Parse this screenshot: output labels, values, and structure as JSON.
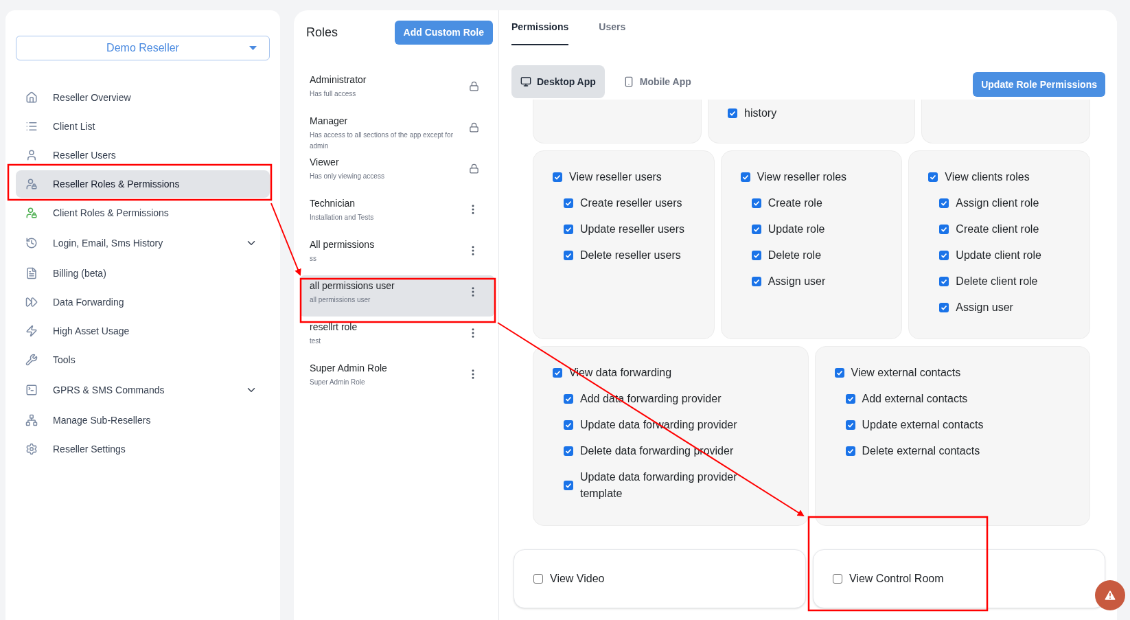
{
  "account_select": {
    "value": "Demo Reseller"
  },
  "sidebar": {
    "items": [
      {
        "label": "Reseller Overview",
        "selected": false
      },
      {
        "label": "Client List",
        "selected": false
      },
      {
        "label": "Reseller Users",
        "selected": false
      },
      {
        "label": "Reseller Roles & Permissions",
        "selected": true
      },
      {
        "label": "Client Roles & Permissions",
        "selected": false
      },
      {
        "label": "Login, Email, Sms History",
        "selected": false,
        "expanded": false
      },
      {
        "label": "Billing (beta)",
        "selected": false
      },
      {
        "label": "Data Forwarding",
        "selected": false
      },
      {
        "label": "High Asset Usage",
        "selected": false
      },
      {
        "label": "Tools",
        "selected": false
      },
      {
        "label": "GPRS & SMS Commands",
        "selected": false,
        "expanded": false
      },
      {
        "label": "Manage Sub-Resellers",
        "selected": false
      },
      {
        "label": "Reseller Settings",
        "selected": false
      }
    ]
  },
  "roles": {
    "title": "Roles",
    "add_button": "Add Custom Role",
    "items": [
      {
        "name": "Administrator",
        "description": "Has full access",
        "locked": true,
        "selected": false
      },
      {
        "name": "Manager",
        "description": "Has access to all sections of the app except for admin",
        "locked": true,
        "selected": false
      },
      {
        "name": "Viewer",
        "description": "Has only viewing access",
        "locked": true,
        "selected": false
      },
      {
        "name": "Technician",
        "description": "Installation and Tests",
        "locked": false,
        "selected": false
      },
      {
        "name": "All permissions",
        "description": "ss",
        "locked": false,
        "selected": false
      },
      {
        "name": "all permissions user",
        "description": "all permissions user",
        "locked": false,
        "selected": true
      },
      {
        "name": "resellrt role",
        "description": "test",
        "locked": false,
        "selected": false
      },
      {
        "name": "Super Admin Role",
        "description": "Super Admin Role",
        "locked": false,
        "selected": false
      }
    ]
  },
  "tabs": [
    {
      "label": "Permissions",
      "selected": true
    },
    {
      "label": "Users",
      "selected": false
    }
  ],
  "app_tabs": [
    {
      "label": "Desktop App",
      "selected": true
    },
    {
      "label": "Mobile App",
      "selected": false
    }
  ],
  "update_button": "Update Role Permissions",
  "permission_rows": [
    {
      "kind": "partial",
      "cards": [
        {
          "kind": "empty"
        },
        {
          "kind": "list",
          "items": [
            {
              "label": "history",
              "checked": true
            }
          ]
        },
        {
          "kind": "empty"
        }
      ]
    },
    {
      "kind": "grey",
      "cards": [
        {
          "kind": "list",
          "items": [
            {
              "label": "View reseller users",
              "checked": true,
              "children": [
                {
                  "label": "Create reseller users",
                  "checked": true
                },
                {
                  "label": "Update reseller users",
                  "checked": true
                },
                {
                  "label": "Delete reseller users",
                  "checked": true
                }
              ]
            }
          ]
        },
        {
          "kind": "list",
          "items": [
            {
              "label": "View reseller roles",
              "checked": true,
              "children": [
                {
                  "label": "Create role",
                  "checked": true
                },
                {
                  "label": "Update role",
                  "checked": true
                },
                {
                  "label": "Delete role",
                  "checked": true
                },
                {
                  "label": "Assign user",
                  "checked": true
                }
              ]
            }
          ]
        },
        {
          "kind": "list",
          "items": [
            {
              "label": "View clients roles",
              "checked": true,
              "children": [
                {
                  "label": "Assign client role",
                  "checked": true
                },
                {
                  "label": "Create client role",
                  "checked": true
                },
                {
                  "label": "Update client role",
                  "checked": true
                },
                {
                  "label": "Delete client role",
                  "checked": true
                },
                {
                  "label": "Assign user",
                  "checked": true
                }
              ]
            }
          ]
        }
      ]
    },
    {
      "kind": "grey",
      "cards": [
        {
          "kind": "list",
          "items": [
            {
              "label": "View data forwarding",
              "checked": true,
              "children": [
                {
                  "label": "Add data forwarding provider",
                  "checked": true
                },
                {
                  "label": "Update data forwarding provider",
                  "checked": true
                },
                {
                  "label": "Delete data forwarding provider",
                  "checked": true
                },
                {
                  "label": "Update data forwarding provider template",
                  "checked": true
                }
              ]
            }
          ]
        },
        {
          "kind": "list",
          "items": [
            {
              "label": "View external contacts",
              "checked": true,
              "children": [
                {
                  "label": "Add external contacts",
                  "checked": true
                },
                {
                  "label": "Update external contacts",
                  "checked": true
                },
                {
                  "label": "Delete external contacts",
                  "checked": true
                }
              ]
            }
          ]
        }
      ]
    },
    {
      "kind": "plain",
      "cards": [
        {
          "kind": "list",
          "items": [
            {
              "label": "View Video",
              "checked": false
            }
          ]
        },
        {
          "kind": "list",
          "items": [
            {
              "label": "View Control Room",
              "checked": false
            }
          ]
        }
      ]
    }
  ]
}
